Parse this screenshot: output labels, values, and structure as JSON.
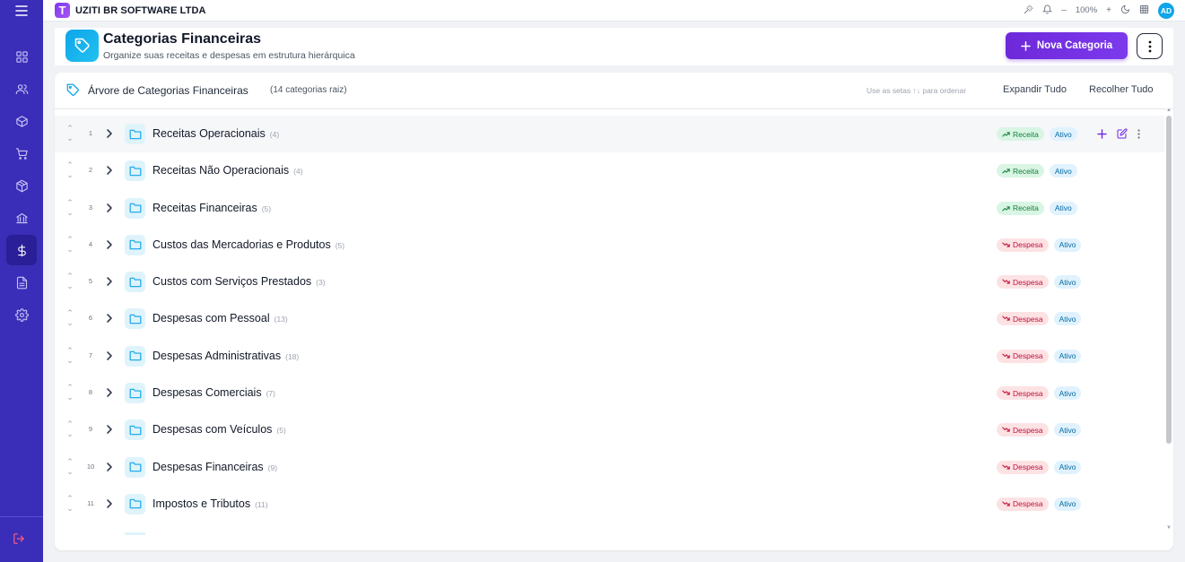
{
  "app": {
    "company": "UZITI BR SOFTWARE LTDA",
    "logo_letter": "T",
    "zoom": "100%",
    "avatar": "AD"
  },
  "sidebar": {
    "items": [
      {
        "icon": "dashboard-icon",
        "active": false
      },
      {
        "icon": "users-icon",
        "active": false
      },
      {
        "icon": "box-icon",
        "active": false
      },
      {
        "icon": "cart-icon",
        "active": false
      },
      {
        "icon": "package-icon",
        "active": false
      },
      {
        "icon": "bank-icon",
        "active": false
      },
      {
        "icon": "dollar-icon",
        "active": true
      },
      {
        "icon": "document-icon",
        "active": false
      },
      {
        "icon": "settings-icon",
        "active": false
      }
    ]
  },
  "header": {
    "title": "Categorias Financeiras",
    "subtitle": "Organize suas receitas e despesas em estrutura hierárquica",
    "new_button": "Nova Categoria"
  },
  "tree": {
    "title": "Árvore de Categorias Financeiras",
    "count_label": "(14 categorias raiz)",
    "hint": "Use as setas ↑↓ para ordenar",
    "expand_all": "Expandir Tudo",
    "collapse_all": "Recolher Tudo",
    "rows": [
      {
        "num": "1",
        "name": "Receitas Operacionais",
        "count": "(4)",
        "type": "Receita",
        "status": "Ativo"
      },
      {
        "num": "2",
        "name": "Receitas Não Operacionais",
        "count": "(4)",
        "type": "Receita",
        "status": "Ativo"
      },
      {
        "num": "3",
        "name": "Receitas Financeiras",
        "count": "(5)",
        "type": "Receita",
        "status": "Ativo"
      },
      {
        "num": "4",
        "name": "Custos das Mercadorias e Produtos",
        "count": "(5)",
        "type": "Despesa",
        "status": "Ativo"
      },
      {
        "num": "5",
        "name": "Custos com Serviços Prestados",
        "count": "(3)",
        "type": "Despesa",
        "status": "Ativo"
      },
      {
        "num": "6",
        "name": "Despesas com Pessoal",
        "count": "(13)",
        "type": "Despesa",
        "status": "Ativo"
      },
      {
        "num": "7",
        "name": "Despesas Administrativas",
        "count": "(18)",
        "type": "Despesa",
        "status": "Ativo"
      },
      {
        "num": "8",
        "name": "Despesas Comerciais",
        "count": "(7)",
        "type": "Despesa",
        "status": "Ativo"
      },
      {
        "num": "9",
        "name": "Despesas com Veículos",
        "count": "(5)",
        "type": "Despesa",
        "status": "Ativo"
      },
      {
        "num": "10",
        "name": "Despesas Financeiras",
        "count": "(9)",
        "type": "Despesa",
        "status": "Ativo"
      },
      {
        "num": "11",
        "name": "Impostos e Tributos",
        "count": "(11)",
        "type": "Despesa",
        "status": "Ativo"
      }
    ]
  },
  "colors": {
    "sidebar": "#3a2db8",
    "primary": "#6d28d9",
    "accent": "#0ea5e9"
  }
}
